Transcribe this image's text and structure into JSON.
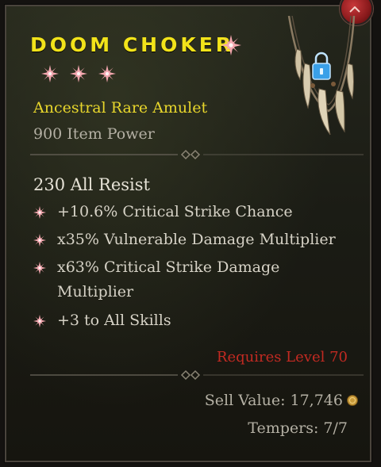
{
  "item": {
    "name": "DOOM CHOKER",
    "type": "Ancestral Rare Amulet",
    "power": "900 Item Power",
    "greater_affix_marks": 3
  },
  "stats": {
    "resist": "230 All Resist",
    "affixes": [
      "+10.6% Critical Strike Chance",
      "x35% Vulnerable Damage Multiplier",
      "x63% Critical Strike Damage Multiplier",
      "+3 to All Skills"
    ]
  },
  "footer": {
    "requirement": "Requires Level 70",
    "sell_value": "Sell Value: 17,746",
    "tempers": "Tempers: 7/7"
  },
  "colors": {
    "name": "#f2e31a",
    "type": "#e8d62c",
    "requirement": "#c22a22",
    "affix_mark": "#f0a0a8"
  },
  "icons": {
    "greater_affix": "flower-star-icon",
    "lock": "padlock-icon",
    "currency": "gold-coin-icon",
    "item_art": "tooth-necklace-icon"
  }
}
